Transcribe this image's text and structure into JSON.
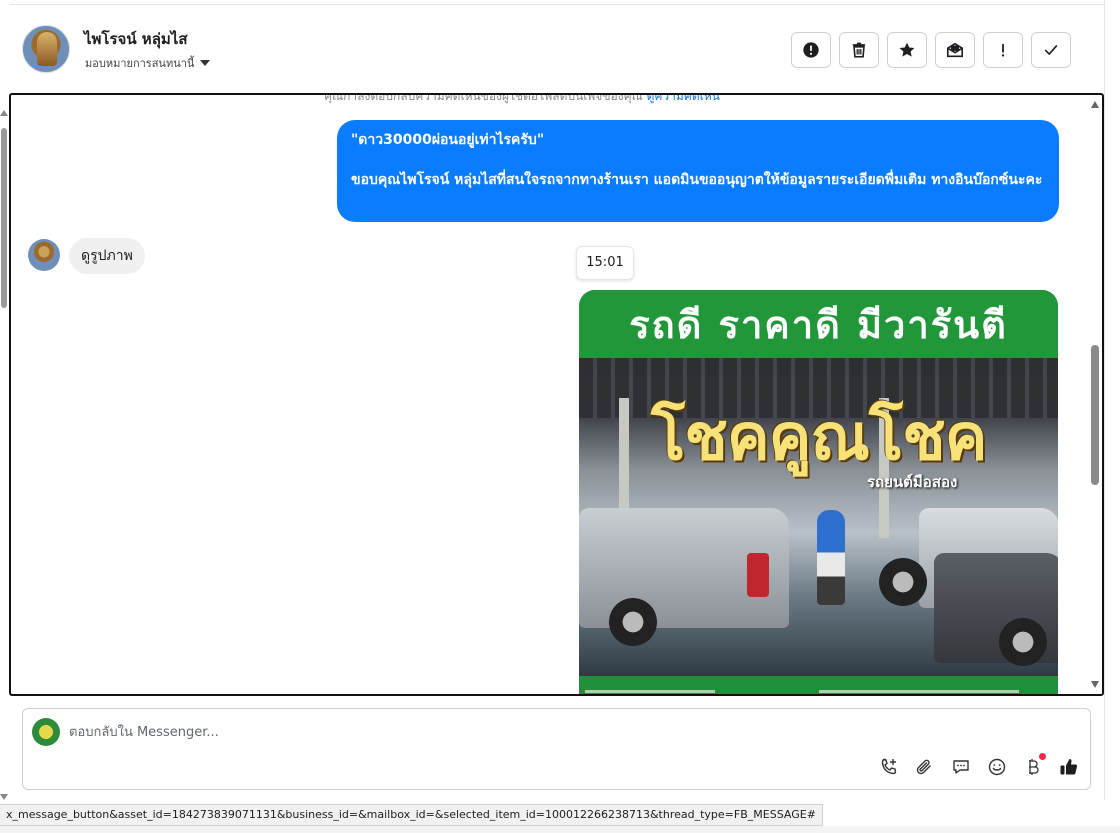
{
  "header": {
    "contact_name": "ไพโรจน์ หลุ่มไส",
    "assign_label": "มอบหมายการสนทนานี้",
    "actions": [
      {
        "name": "report-icon",
        "label": "report"
      },
      {
        "name": "trash-icon",
        "label": "delete"
      },
      {
        "name": "star-icon",
        "label": "star"
      },
      {
        "name": "mark-unread-icon",
        "label": "mark unread"
      },
      {
        "name": "exclamation-icon",
        "label": "follow up"
      },
      {
        "name": "check-icon",
        "label": "done"
      }
    ]
  },
  "thread": {
    "notice_text": "คุณกำลังตอบกลับความคิดเห็นของผู้ใช้ต่อโพสต์บนเพจของคุณ",
    "notice_link": "ดูความคิดเห็น",
    "outgoing_quote": "\"ดาว30000ผ่อนอยู่เท่าไรครับ\"",
    "outgoing_text": "ขอบคุณไพโรจน์ หลุ่มไสที่สนใจรถจากทางร้านเรา แอดมินขออนุญาตให้ข้อมูลรายระเอียดพื่มเติม ทางอินบ๊อกซ์นะคะ",
    "incoming_text": "ดูรูปภาพ",
    "timestamp": "15:01",
    "ad_banner": "รถดี ราคาดี มีวารันตี",
    "ad_title": "โชคคูณโชค",
    "ad_subtitle": "รถยนต์มือสอง"
  },
  "composer": {
    "placeholder": "ตอบกลับใน Messenger...",
    "tools": [
      "call-add-icon",
      "paperclip-icon",
      "chat-bubble-icon",
      "emoji-icon",
      "bitcoin-icon",
      "thumbs-up-icon"
    ]
  },
  "status_url": "x_message_button&asset_id=184273839071131&business_id=&mailbox_id=&selected_item_id=100012266238713&thread_type=FB_MESSAGE#",
  "colors": {
    "outgoing_bubble": "#0a7cff",
    "incoming_bubble": "#f0f0f0",
    "ad_green": "#22973a",
    "ad_title": "#f7e27a",
    "notification_dot": "#f02849"
  }
}
